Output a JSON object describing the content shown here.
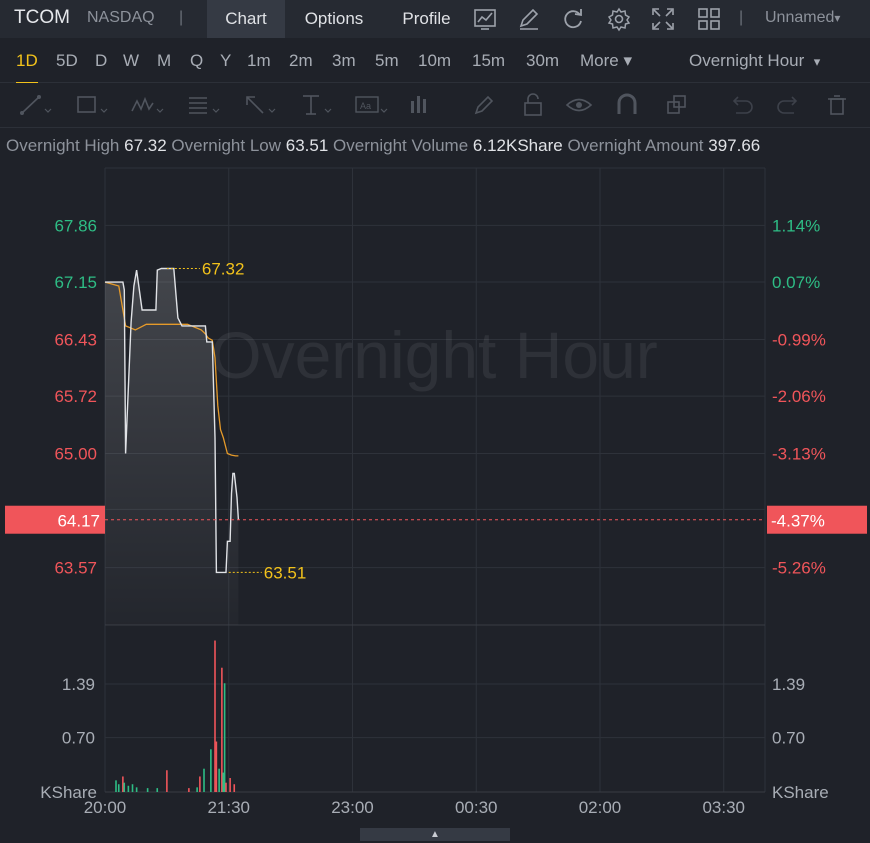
{
  "header": {
    "ticker": "TCOM",
    "exchange": "NASDAQ",
    "separator": "|",
    "tabs": [
      {
        "label": "Chart",
        "active": true
      },
      {
        "label": "Options",
        "active": false
      },
      {
        "label": "Profile",
        "active": false
      }
    ],
    "icons": [
      "chart-type-icon",
      "edit-icon",
      "refresh-icon",
      "settings-icon",
      "fullscreen-icon",
      "layout-icon"
    ],
    "layout_name": "Unnamed",
    "layout_caret": "▾"
  },
  "periods": {
    "items": [
      "1D",
      "5D",
      "D",
      "W",
      "M",
      "Q",
      "Y",
      "1m",
      "2m",
      "3m",
      "5m",
      "10m",
      "15m",
      "30m",
      "More ▾"
    ],
    "active": "1D",
    "session": "Overnight Hour",
    "session_caret": "▾"
  },
  "drawing_tools": [
    "line-tool-icon",
    "rectangle-tool-icon",
    "wave-tool-icon",
    "fib-tool-icon",
    "arrow-tool-icon",
    "measure-tool-icon",
    "text-tool-icon",
    "bars-tool-icon",
    "pen-icon",
    "lock-icon",
    "eye-icon",
    "magnet-icon",
    "layers-icon",
    "undo-icon",
    "redo-icon",
    "trash-icon"
  ],
  "info_bar": {
    "high_label": "Overnight High",
    "high_value": "67.32",
    "low_label": "Overnight Low",
    "low_value": "63.51",
    "volume_label": "Overnight Volume",
    "volume_value": "6.12KShare",
    "amount_label": "Overnight Amount",
    "amount_value": "397.66"
  },
  "colors": {
    "up": "#2ebd85",
    "down": "#f0555a",
    "price_line": "#e0e2e6",
    "avg_line": "#e59a2a",
    "annotation": "#f2c21b",
    "current_tag": "#f0555a"
  },
  "chart_data": {
    "type": "line",
    "watermark": "Overnight Hour",
    "x_ticks": [
      "20:00",
      "21:30",
      "23:00",
      "00:30",
      "02:00",
      "03:30"
    ],
    "x_range_minutes": [
      0,
      480
    ],
    "price_axis": {
      "left_labels": [
        "67.86",
        "67.15",
        "66.43",
        "65.72",
        "65.00",
        "63.57"
      ],
      "right_labels": [
        "1.14%",
        "0.07%",
        "-0.99%",
        "-2.06%",
        "-3.13%",
        "-5.26%"
      ],
      "label_colors": [
        "up",
        "up",
        "down",
        "down",
        "down",
        "down"
      ],
      "ylim": [
        62.85,
        68.58
      ]
    },
    "current": {
      "price": "64.17",
      "change": "-4.37%",
      "value": 64.17
    },
    "high_annotation": {
      "label": "67.32",
      "value": 67.32,
      "minute": 45
    },
    "low_annotation": {
      "label": "63.51",
      "value": 63.51,
      "minute": 90
    },
    "price_series": {
      "minutes": [
        0,
        13,
        14,
        15,
        19,
        21,
        23,
        27,
        37,
        38,
        41,
        50,
        53,
        56,
        62,
        73,
        74,
        78,
        80,
        81,
        85,
        88,
        89,
        91,
        92,
        93,
        94,
        96,
        97
      ],
      "values": [
        67.15,
        67.15,
        67.05,
        65.0,
        66.65,
        67.1,
        67.3,
        66.8,
        66.8,
        67.3,
        67.32,
        67.32,
        66.7,
        66.6,
        66.6,
        66.6,
        66.4,
        66.4,
        65.2,
        63.51,
        63.51,
        63.51,
        63.9,
        63.9,
        64.5,
        64.75,
        64.75,
        64.45,
        64.17
      ]
    },
    "avg_series": {
      "minutes": [
        0,
        10,
        13,
        15,
        22,
        30,
        60,
        70,
        73,
        75,
        78,
        80,
        82,
        84,
        86,
        89,
        92,
        95,
        97
      ],
      "values": [
        67.15,
        67.1,
        66.8,
        66.6,
        66.55,
        66.62,
        66.62,
        66.55,
        66.5,
        66.45,
        66.42,
        66.2,
        65.6,
        65.3,
        65.2,
        65.0,
        64.98,
        64.97,
        64.97
      ]
    },
    "volume": {
      "unit_label": "KShare",
      "labels": [
        "1.39",
        "0.70"
      ],
      "ylim": [
        0,
        2.15
      ],
      "bars": [
        {
          "minute": 8,
          "v": 0.15,
          "c": "up"
        },
        {
          "minute": 10,
          "v": 0.1,
          "c": "up"
        },
        {
          "minute": 13,
          "v": 0.2,
          "c": "down"
        },
        {
          "minute": 14,
          "v": 0.12,
          "c": "up"
        },
        {
          "minute": 17,
          "v": 0.08,
          "c": "up"
        },
        {
          "minute": 20,
          "v": 0.1,
          "c": "up"
        },
        {
          "minute": 23,
          "v": 0.06,
          "c": "up"
        },
        {
          "minute": 31,
          "v": 0.05,
          "c": "up"
        },
        {
          "minute": 38,
          "v": 0.05,
          "c": "up"
        },
        {
          "minute": 45,
          "v": 0.28,
          "c": "down"
        },
        {
          "minute": 61,
          "v": 0.05,
          "c": "down"
        },
        {
          "minute": 67,
          "v": 0.06,
          "c": "up"
        },
        {
          "minute": 69,
          "v": 0.2,
          "c": "down"
        },
        {
          "minute": 72,
          "v": 0.3,
          "c": "up"
        },
        {
          "minute": 77,
          "v": 0.55,
          "c": "up"
        },
        {
          "minute": 80,
          "v": 1.95,
          "c": "down"
        },
        {
          "minute": 81,
          "v": 0.65,
          "c": "down"
        },
        {
          "minute": 83,
          "v": 0.3,
          "c": "up"
        },
        {
          "minute": 85,
          "v": 1.6,
          "c": "down"
        },
        {
          "minute": 86,
          "v": 0.25,
          "c": "up"
        },
        {
          "minute": 87,
          "v": 1.4,
          "c": "up"
        },
        {
          "minute": 88,
          "v": 0.12,
          "c": "down"
        },
        {
          "minute": 91,
          "v": 0.18,
          "c": "down"
        },
        {
          "minute": 94,
          "v": 0.1,
          "c": "down"
        }
      ]
    }
  }
}
